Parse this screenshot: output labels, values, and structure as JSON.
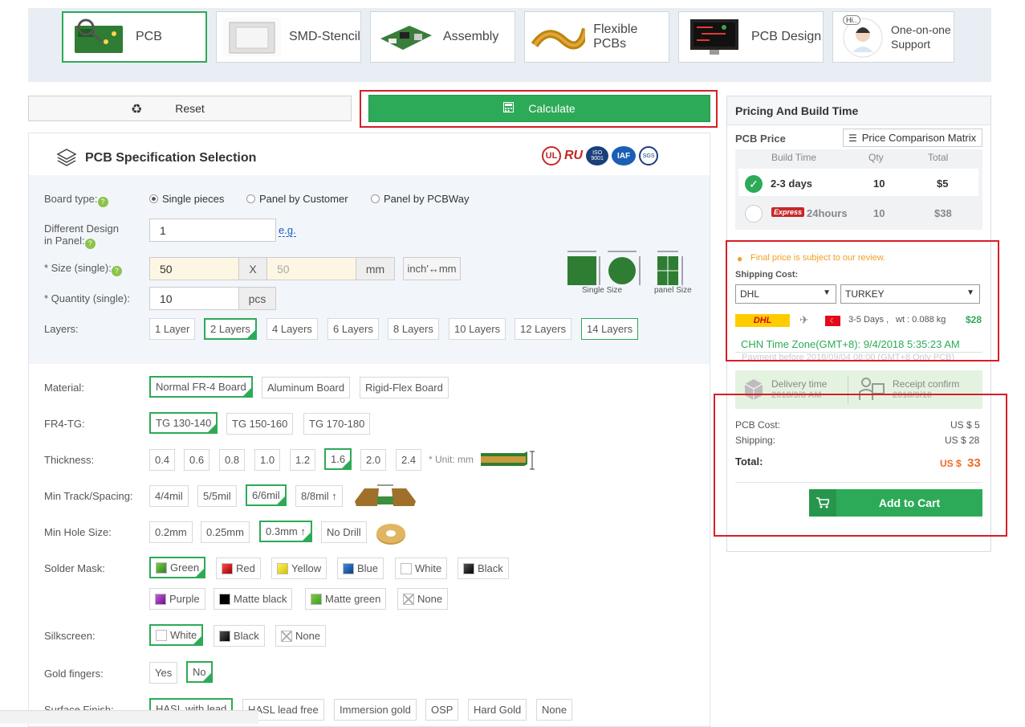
{
  "nav": {
    "tabs": [
      {
        "label": "PCB",
        "icon": "pcb-icon",
        "active": true
      },
      {
        "label": "SMD-Stencil",
        "icon": "stencil-icon"
      },
      {
        "label": "Assembly",
        "icon": "assembly-icon"
      },
      {
        "label": "Flexible PCBs",
        "icon": "flex-pcb-icon"
      },
      {
        "label": "PCB Design",
        "icon": "pcb-design-icon"
      },
      {
        "label1": "One-on-one",
        "label2": "Support",
        "icon": "support-avatar-icon",
        "bubble": "Hi.."
      }
    ]
  },
  "actions": {
    "reset": "Reset",
    "calculate": "Calculate"
  },
  "spec": {
    "title": "PCB Specification Selection",
    "certs": [
      "UL",
      "RU",
      "ISO 9001",
      "IAF",
      "SGS"
    ],
    "board_type": {
      "label": "Board type:",
      "options": [
        "Single pieces",
        "Panel by Customer",
        "Panel by PCBWay"
      ],
      "selected": 0
    },
    "different_design": {
      "label1": "Different Design",
      "label2": "in Panel:",
      "value": "1",
      "eg": "e.g."
    },
    "size": {
      "label": "* Size (single):",
      "w": "50",
      "x": "X",
      "h": "50",
      "unit": "mm",
      "convert": "inch'↔mm"
    },
    "quantity": {
      "label": "* Quantity (single):",
      "value": "10",
      "unit": "pcs"
    },
    "size_diagrams": {
      "single": "Single Size",
      "panel": "panel Size"
    },
    "layers": {
      "label": "Layers:",
      "options": [
        "1 Layer",
        "2 Layers",
        "4 Layers",
        "6 Layers",
        "8 Layers",
        "10 Layers",
        "12 Layers",
        "14 Layers"
      ]
    },
    "material": {
      "label": "Material:",
      "options": [
        "Normal FR-4 Board",
        "Aluminum Board",
        "Rigid-Flex Board"
      ]
    },
    "fr4tg": {
      "label": "FR4-TG:",
      "options": [
        "TG 130-140",
        "TG 150-160",
        "TG 170-180"
      ]
    },
    "thickness": {
      "label": "Thickness:",
      "options": [
        "0.4",
        "0.6",
        "0.8",
        "1.0",
        "1.2",
        "1.6",
        "2.0",
        "2.4"
      ],
      "unit": "* Unit: mm"
    },
    "track": {
      "label": "Min Track/Spacing:",
      "options": [
        "4/4mil",
        "5/5mil",
        "6/6mil",
        "8/8mil ↑"
      ]
    },
    "hole": {
      "label": "Min Hole Size:",
      "options": [
        "0.2mm",
        "0.25mm",
        "0.3mm ↑",
        "No Drill"
      ]
    },
    "soldermask": {
      "label": "Solder Mask:",
      "options": [
        {
          "label": "Green",
          "color": "#4caf22"
        },
        {
          "label": "Red",
          "color": "#d0161b"
        },
        {
          "label": "Yellow",
          "color": "#f0e01a"
        },
        {
          "label": "Blue",
          "color": "#1c62b8"
        },
        {
          "label": "White",
          "color": "#ffffff"
        },
        {
          "label": "Black",
          "color": "#111111"
        },
        {
          "label": "Purple",
          "color": "#8e2aa8"
        },
        {
          "label": "Matte black",
          "color": "#111111"
        },
        {
          "label": "Matte green",
          "color": "#4caf22"
        },
        {
          "label": "None",
          "color": "none"
        }
      ]
    },
    "silkscreen": {
      "label": "Silkscreen:",
      "options": [
        {
          "label": "White",
          "color": "#ffffff"
        },
        {
          "label": "Black",
          "color": "#111111"
        },
        {
          "label": "None",
          "color": "none"
        }
      ]
    },
    "goldfingers": {
      "label": "Gold fingers:",
      "options": [
        "Yes",
        "No"
      ]
    },
    "surface": {
      "label": "Surface Finish:",
      "options": [
        "HASL with lead",
        "HASL lead free",
        "Immersion gold",
        "OSP",
        "Hard Gold",
        "None"
      ]
    }
  },
  "pricing": {
    "title": "Pricing And Build Time",
    "pcb_price": "PCB Price",
    "matrix_btn": "Price Comparison Matrix",
    "headers": [
      "Build Time",
      "Qty",
      "Total"
    ],
    "rows": [
      {
        "time": "2-3 days",
        "qty": "10",
        "total": "$5",
        "selected": true
      },
      {
        "badge": "Express",
        "time": "24hours",
        "qty": "10",
        "total": "$38"
      }
    ],
    "notice": "Final price is subject to our review.",
    "shipping_label": "Shipping Cost:",
    "carrier": "DHL",
    "country": "TURKEY",
    "dhl_logo": "DHL",
    "days": "3-5 Days ,",
    "weight": "wt : 0.088 kg",
    "ship_price": "$28",
    "timezone": "CHN Time Zone(GMT+8): 9/4/2018 5:35:23 AM",
    "payment_before": "Payment before 2018/09/04 08:00 (GMT+8 Only PCB)",
    "delivery_label": "Delivery time",
    "delivery_date": "2018/9/8 AM",
    "receipt_label": "Receipt confirm",
    "receipt_date": "2018/9/10",
    "pcb_cost_label": "PCB Cost:",
    "pcb_cost": "US $ 5",
    "shipping_cost_label": "Shipping:",
    "shipping_cost": "US $ 28",
    "total_label": "Total:",
    "total_prefix": "US $",
    "total_value": "33",
    "add_to_cart": "Add to Cart"
  }
}
